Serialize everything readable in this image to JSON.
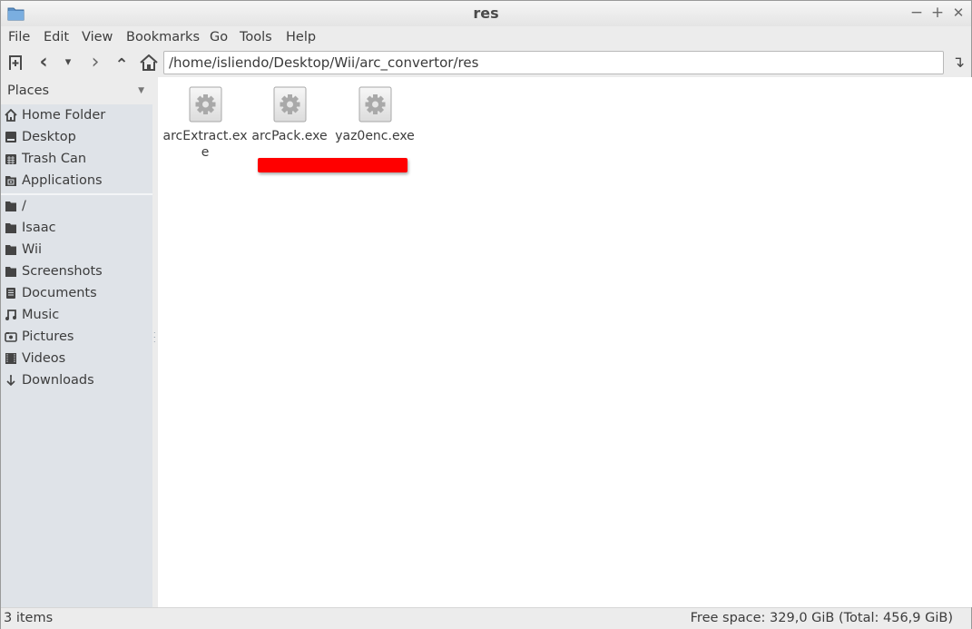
{
  "window": {
    "title": "res",
    "controls": {
      "minimize": "−",
      "maximize": "+",
      "close": "✕"
    }
  },
  "menubar": {
    "items": [
      "File",
      "Edit",
      "View",
      "Bookmarks",
      "Go",
      "Tools",
      "Help"
    ]
  },
  "toolbar": {
    "new_tab_icon": "new-tab-icon",
    "back_icon": "‹",
    "history_icon": "▾",
    "forward_icon": "›",
    "up_icon": "⌃",
    "home_icon": "home-icon",
    "path": "/home/isliendo/Desktop/Wii/arc_convertor/res",
    "go_icon": "↴"
  },
  "sidebar": {
    "header": "Places",
    "items": [
      {
        "label": "Home Folder",
        "icon": "home-icon"
      },
      {
        "label": "Desktop",
        "icon": "desktop-icon"
      },
      {
        "label": "Trash Can",
        "icon": "trash-icon"
      },
      {
        "label": "Applications",
        "icon": "applications-icon"
      },
      {
        "label": "/",
        "icon": "folder-icon"
      },
      {
        "label": "Isaac",
        "icon": "folder-icon"
      },
      {
        "label": "Wii",
        "icon": "folder-icon"
      },
      {
        "label": "Screenshots",
        "icon": "folder-icon"
      },
      {
        "label": "Documents",
        "icon": "documents-icon"
      },
      {
        "label": "Music",
        "icon": "music-icon"
      },
      {
        "label": "Pictures",
        "icon": "pictures-icon"
      },
      {
        "label": "Videos",
        "icon": "videos-icon"
      },
      {
        "label": "Downloads",
        "icon": "downloads-icon"
      }
    ]
  },
  "files": [
    {
      "name": "arcExtract.exe",
      "icon": "executable-gear-icon"
    },
    {
      "name": "arcPack.exe",
      "icon": "executable-gear-icon"
    },
    {
      "name": "yaz0enc.exe",
      "icon": "executable-gear-icon"
    }
  ],
  "statusbar": {
    "item_count": "3 items",
    "free_space": "Free space: 329,0 GiB (Total: 456,9 GiB)"
  },
  "colors": {
    "redaction": "#ff0000",
    "sidebar_bg": "#dfe3e8"
  }
}
